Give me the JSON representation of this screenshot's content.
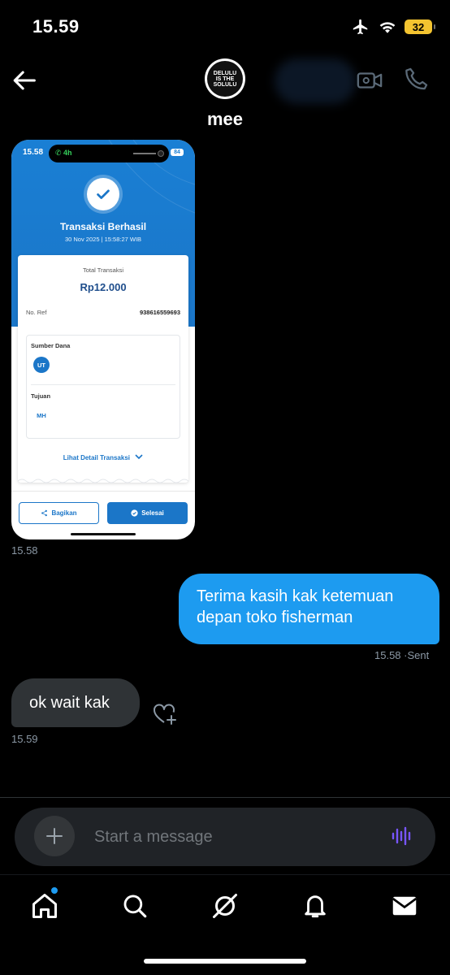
{
  "status_bar": {
    "time": "15.59",
    "battery": "32",
    "icons": [
      "airplane-icon",
      "wifi-icon",
      "battery-icon"
    ]
  },
  "header": {
    "name": "mee",
    "avatar_text": "DELULU IS THE SOLULU",
    "icons": [
      "back-arrow-icon",
      "video-call-icon",
      "phone-call-icon"
    ]
  },
  "messages": [
    {
      "type": "image",
      "direction": "incoming",
      "timestamp": "15.58",
      "screenshot": {
        "status_time": "15.58",
        "call_badge": "4h",
        "battery": "84",
        "title": "Transaksi Berhasil",
        "date": "30 Nov 2025 | 15:58:27 WIB",
        "total_label": "Total Transaksi",
        "amount": "Rp12.000",
        "ref_label": "No. Ref",
        "ref_value": "938616559693",
        "source_label": "Sumber Dana",
        "source_initials": "UT",
        "dest_label": "Tujuan",
        "dest_initials": "MH",
        "detail_link": "Lihat Detail Transaksi",
        "share_label": "Bagikan",
        "done_label": "Selesai"
      }
    },
    {
      "type": "text",
      "direction": "outgoing",
      "text": "Terima kasih kak ketemuan depan toko fisherman",
      "timestamp": "15.58",
      "status": "Sent"
    },
    {
      "type": "text",
      "direction": "incoming",
      "text": "ok wait kak",
      "timestamp": "15.59"
    }
  ],
  "composer": {
    "placeholder": "Start a message",
    "accent": "#7856ff"
  },
  "tabbar": {
    "items": [
      "home-icon",
      "search-icon",
      "grok-icon",
      "notifications-icon",
      "messages-icon"
    ]
  },
  "colors": {
    "outgoing_bubble": "#1d9bf0",
    "incoming_bubble": "#2f3336",
    "timestamp": "#8b98a5",
    "background": "#000000"
  }
}
